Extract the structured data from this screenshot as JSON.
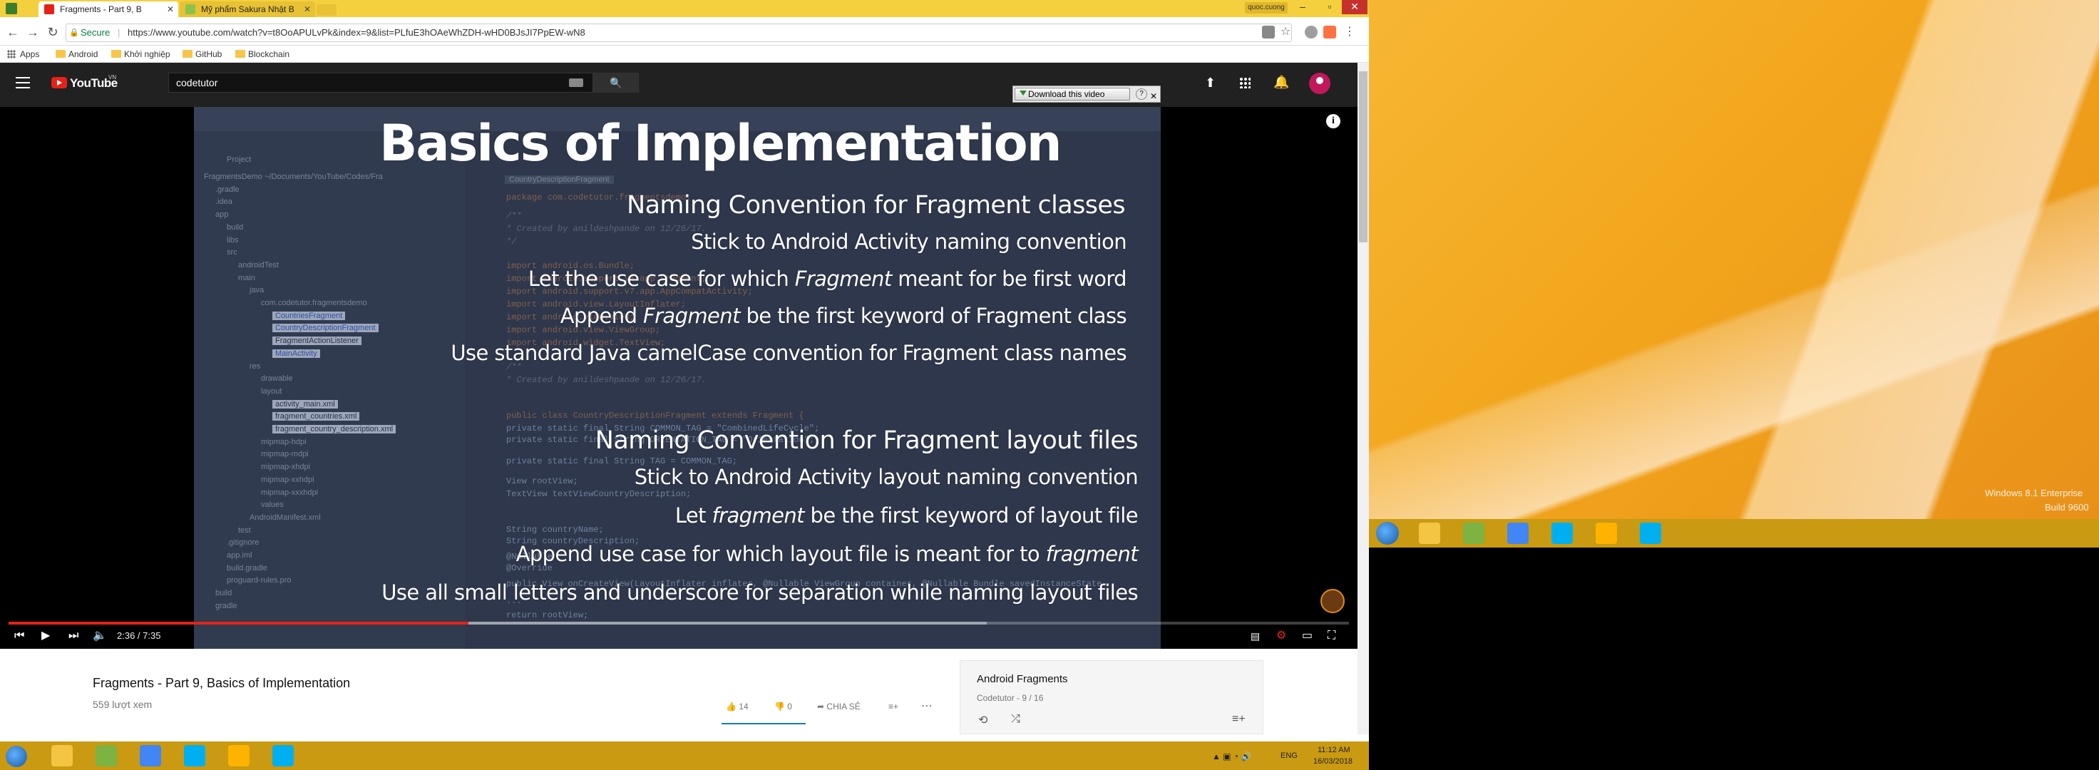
{
  "browser": {
    "tabs": [
      {
        "label": "Fragments - Part 9, B",
        "favicon_color": "#e62117"
      },
      {
        "label": "Mỹ phẩm Sakura Nhật B",
        "favicon_color": "#8bc34a"
      }
    ],
    "profile_chip": "quoc.cuong",
    "secure_label": "Secure",
    "url": "https://www.youtube.com/watch?v=t8OoAPULvPk&index=9&list=PLfuE3hOAeWhZDH-wHD0BJsJI7PpEW-wN8",
    "window_controls": {
      "minimize": "–",
      "maximize": "▫",
      "close": "✕"
    },
    "bookmarks": [
      {
        "label": "Apps",
        "kind": "apps"
      },
      {
        "label": "Android",
        "kind": "folder"
      },
      {
        "label": "Khởi nghiệp",
        "kind": "folder"
      },
      {
        "label": "GitHub",
        "kind": "folder"
      },
      {
        "label": "Blockchain",
        "kind": "folder"
      }
    ]
  },
  "youtube": {
    "logo_text": "YouTube",
    "logo_country": "VN",
    "search_value": "codetutor",
    "search_button": "🔍"
  },
  "video": {
    "download_label": "Download this video",
    "download_help": "?",
    "download_close": "✕",
    "slide_title": "Basics of Implementation",
    "section1_heading": "Naming Convention for Fragment classes",
    "section1_lines": [
      {
        "pre": "Stick to Android Activity naming convention",
        "em": "",
        "post": ""
      },
      {
        "pre": "Let the use case for which ",
        "em": "Fragment",
        "post": " meant for be first word"
      },
      {
        "pre": "Append ",
        "em": "Fragment",
        "post": " be the first keyword of Fragment class"
      },
      {
        "pre": "Use standard Java camelCase convention for Fragment class names",
        "em": "",
        "post": ""
      }
    ],
    "section2_heading": "Naming Convention for Fragment layout files",
    "section2_lines": [
      {
        "pre": "Stick to Android Activity layout naming convention",
        "em": "",
        "post": ""
      },
      {
        "pre": "Let ",
        "em": "fragment",
        "post": " be the first keyword of layout file"
      },
      {
        "pre": "Append use case for which layout file is meant for to ",
        "em": "fragment",
        "post": ""
      },
      {
        "pre": "Use all small letters and underscore for separation while naming layout files",
        "em": "",
        "post": ""
      }
    ],
    "time_display": "2:36 / 7:35",
    "progress": {
      "played_fraction": 0.343,
      "loaded_fraction": 0.73
    },
    "info_icon": "i",
    "ide": {
      "tab_file": "CountryDescriptionFragment",
      "project_label": "Project",
      "tree": [
        "FragmentsDemo  ~/Documents/YouTube/Codes/Fra",
        ".gradle",
        ".idea",
        "app",
        "build",
        "libs",
        "src",
        "androidTest",
        "main",
        "java",
        "com.codetutor.fragmentsdemo",
        "CountriesFragment",
        "CountryDescriptionFragment",
        "FragmentActionListener",
        "MainActivity",
        "res",
        "drawable",
        "layout",
        "activity_main.xml",
        "fragment_countries.xml",
        "fragment_country_description.xml",
        "mipmap-hdpi",
        "mipmap-mdpi",
        "mipmap-xhdpi",
        "mipmap-xxhdpi",
        "mipmap-xxxhdpi",
        "values",
        "AndroidManifest.xml",
        "test",
        ".gitignore",
        "app.iml",
        "build.gradle",
        "proguard-rules.pro",
        "build",
        "gradle"
      ],
      "code": [
        "package com.codetutor.fragmentsdemo;",
        "/**",
        " * Created by anildeshpande on 12/26/17.",
        " */",
        "import android.os.Bundle;",
        "import android.support.v4.app.Fragment;",
        "import android.support.v7.app.AppCompatActivity;",
        "import android.view.LayoutInflater;",
        "import android.view.View;",
        "import android.view.ViewGroup;",
        "import android.widget.TextView;",
        "/**",
        " * Created by anildeshpande on 12/26/17.",
        "public class CountryDescriptionFragment extends Fragment {",
        "    private static final String COMMON_TAG = \"CombinedLifeCycle\";",
        "    private static final String ORIENTATION_TAG = \"Orientation\";",
        "    private static final String TAG = COMMON_TAG;",
        "    View rootView;",
        "    TextView textViewCountryDescription;",
        "    String countryName;",
        "    String countryDescription;",
        "    @Nullable",
        "    @Override",
        "    public View onCreateView(LayoutInflater inflater, @Nullable ViewGroup container, @Nullable Bundle savedInstanceState",
        "        ...",
        "        return rootView;"
      ]
    }
  },
  "below_video": {
    "title": "Fragments - Part 9, Basics of Implementation",
    "views": "559 lượt xem",
    "likes": "14",
    "dislikes": "0",
    "share": "CHIA SẺ",
    "playlist_title": "Android Fragments",
    "playlist_sub": "Codetutor - 9 / 16"
  },
  "taskbar_left": {
    "icons": [
      {
        "name": "file-explorer-icon",
        "color": "#f4c542"
      },
      {
        "name": "notepad-icon",
        "color": "#7cb342"
      },
      {
        "name": "chrome-icon",
        "color": "#4285f4"
      },
      {
        "name": "skype-icon",
        "color": "#00aff0"
      },
      {
        "name": "avatar-app-icon",
        "color": "#ffb300"
      },
      {
        "name": "skype-alt-icon",
        "color": "#00aff0"
      }
    ],
    "language": "ENG",
    "time": "11:12 AM",
    "date": "16/03/2018"
  },
  "desktop_right": {
    "watermark_line1": "Windows 8.1 Enterprise",
    "watermark_line2": "Build 9600"
  }
}
